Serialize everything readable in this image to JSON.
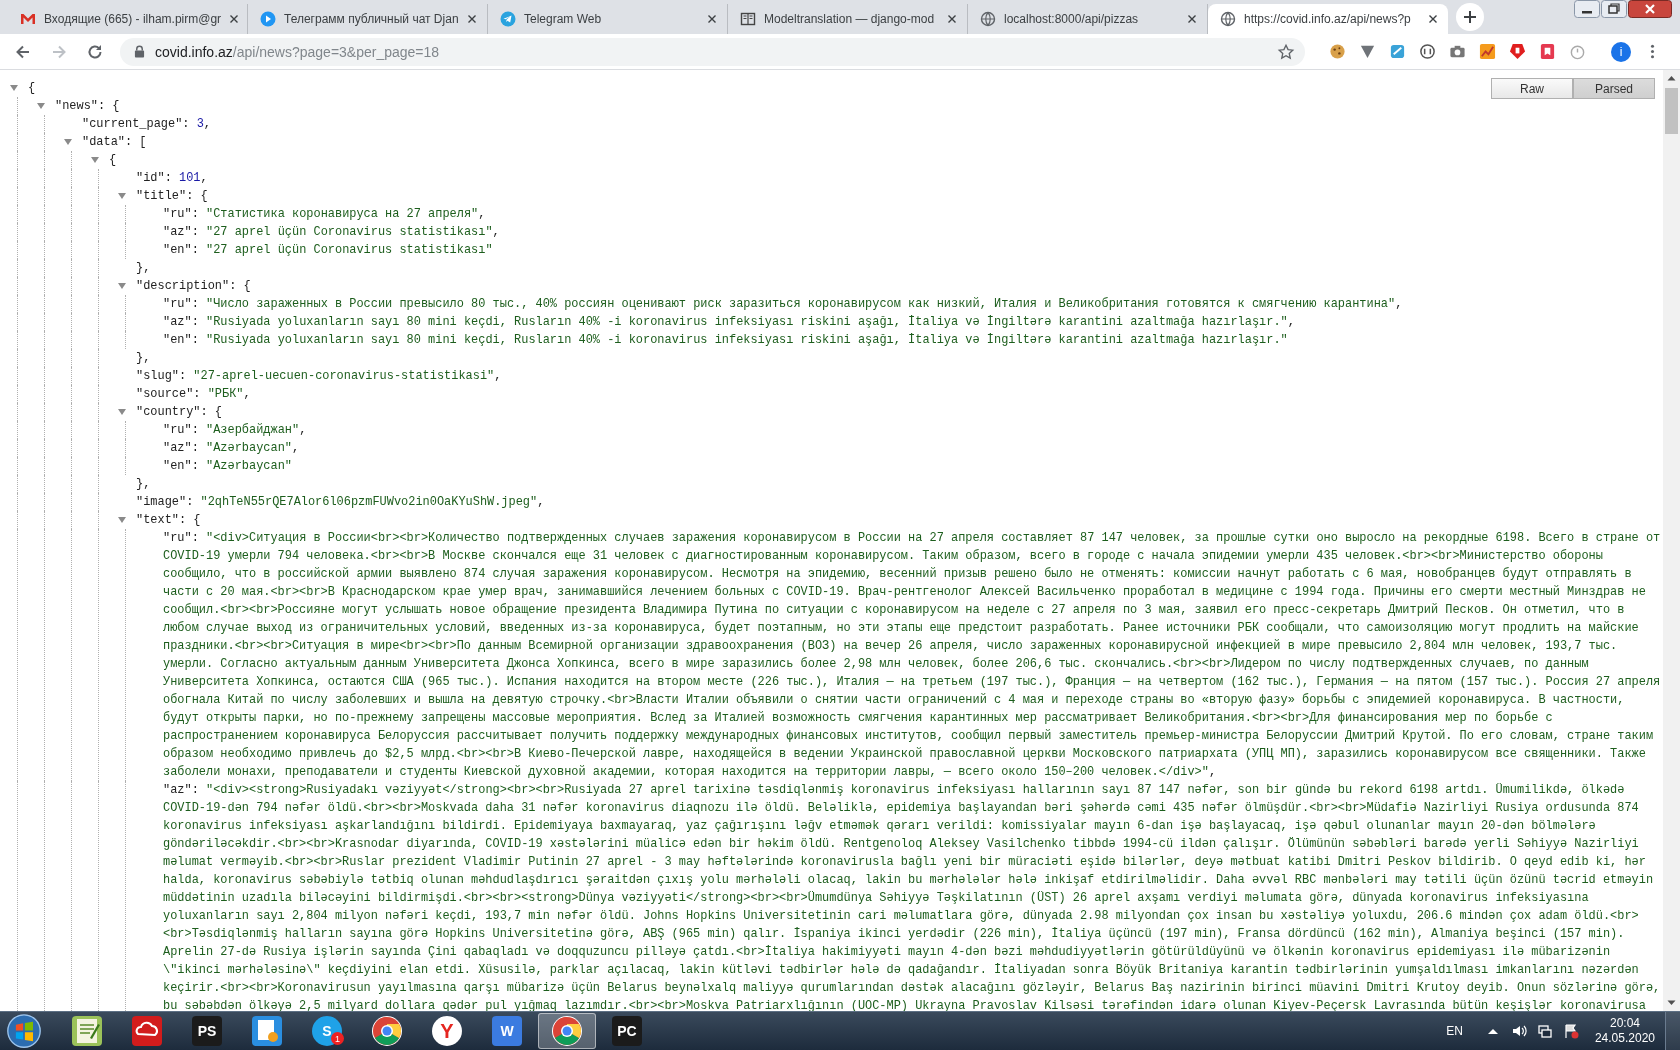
{
  "browser": {
    "tabs": [
      {
        "title": "Входящие (665) - ilham.pirm@gr",
        "kind": "mail",
        "selected": false
      },
      {
        "title": "Телеграмм публичный чат Djan",
        "kind": "play",
        "selected": false
      },
      {
        "title": "Telegram Web",
        "kind": "telegram",
        "selected": false
      },
      {
        "title": "Modeltranslation — django-mod",
        "kind": "book",
        "selected": false
      },
      {
        "title": "localhost:8000/api/pizzas",
        "kind": "globe",
        "selected": false
      },
      {
        "title": "https://covid.info.az/api/news?p",
        "kind": "globe",
        "selected": true
      }
    ],
    "url_host": "covid.info.az",
    "url_path": "/api/news?page=3&per_page=18",
    "profile": "i"
  },
  "viewer": {
    "buttons": [
      {
        "label": "Raw",
        "selected": false
      },
      {
        "label": "Parsed",
        "selected": true
      }
    ],
    "root": {
      "open": "{",
      "expanded": true,
      "children": [
        {
          "key": "\"news\":",
          "open": "{",
          "expanded": true,
          "children": [
            {
              "key": "\"current_page\":",
              "value": "3",
              "kind": "number",
              "tail": ","
            },
            {
              "key": "\"data\":",
              "open": "[",
              "expanded": true,
              "children": [
                {
                  "open": "{",
                  "expanded": true,
                  "children": [
                    {
                      "key": "\"id\":",
                      "value": "101",
                      "kind": "number",
                      "tail": ","
                    },
                    {
                      "key": "\"title\":",
                      "open": "{",
                      "expanded": true,
                      "close": "},",
                      "children": [
                        {
                          "key": "\"ru\":",
                          "value": "\"Статистика коронавируса на 27 апреля\"",
                          "kind": "string",
                          "tail": ","
                        },
                        {
                          "key": "\"az\":",
                          "value": "\"27 aprel üçün Coronavirus statistikası\"",
                          "kind": "string",
                          "tail": ","
                        },
                        {
                          "key": "\"en\":",
                          "value": "\"27 aprel üçün Coronavirus statistikası\"",
                          "kind": "string"
                        }
                      ]
                    },
                    {
                      "key": "\"description\":",
                      "open": "{",
                      "expanded": true,
                      "close": "},",
                      "children": [
                        {
                          "key": "\"ru\":",
                          "value": "\"Число зараженных в России превысило 80 тыс., 40% россиян оценивают риск заразиться коронавирусом как низкий, Италия и Великобритания готовятся к смягчению карантина\"",
                          "kind": "string",
                          "tail": ","
                        },
                        {
                          "key": "\"az\":",
                          "value": "\"Rusiyada yoluxanların sayı 80 mini keçdi, Rusların 40% -i koronavirus infeksiyası riskini aşağı, İtaliya və İngiltərə karantini azaltmağa hazırlaşır.\"",
                          "kind": "string",
                          "tail": ","
                        },
                        {
                          "key": "\"en\":",
                          "value": "\"Rusiyada yoluxanların sayı 80 mini keçdi, Rusların 40% -i koronavirus infeksiyası riskini aşağı, İtaliya və İngiltərə karantini azaltmağa hazırlaşır.\"",
                          "kind": "string"
                        }
                      ]
                    },
                    {
                      "key": "\"slug\":",
                      "value": "\"27-aprel-uecuen-coronavirus-statistikasi\"",
                      "kind": "string",
                      "tail": ","
                    },
                    {
                      "key": "\"source\":",
                      "value": "\"РБК\"",
                      "kind": "string",
                      "tail": ","
                    },
                    {
                      "key": "\"country\":",
                      "open": "{",
                      "expanded": true,
                      "close": "},",
                      "children": [
                        {
                          "key": "\"ru\":",
                          "value": "\"Азербайджан\"",
                          "kind": "string",
                          "tail": ","
                        },
                        {
                          "key": "\"az\":",
                          "value": "\"Azərbaycan\"",
                          "kind": "string",
                          "tail": ","
                        },
                        {
                          "key": "\"en\":",
                          "value": "\"Azərbaycan\"",
                          "kind": "string"
                        }
                      ]
                    },
                    {
                      "key": "\"image\":",
                      "value": "\"2qhTeN55rQE7Alor6l06pzmFUWvo2in0OaKYuShW.jpeg\"",
                      "kind": "string",
                      "tail": ","
                    },
                    {
                      "key": "\"text\":",
                      "open": "{",
                      "expanded": true,
                      "children": [
                        {
                          "key": "\"ru\":",
                          "value": "\"<div>Ситуация в России<br><br>Количество подтвержденных случаев заражения коронавирусом в России на 27 апреля составляет 87 147 человек, за прошлые сутки оно выросло на рекордные 6198. Всего в стране от COVID-19 умерли 794 человека.<br><br>В Москве скончался еще 31 человек с диагностированным коронавирусом. Таким образом, всего в городе с начала эпидемии умерли 435 человек.<br><br>Министерство обороны сообщило, что в российской армии выявлено 874 случая заражения коронавирусом. Несмотря на эпидемию, весенний призыв решено было не отменять: комиссии начнут работать с 6 мая, новобранцев будут отправлять в части с 20 мая.<br><br>В Краснодарском крае умер врач, занимавшийся лечением больных с COVID-19. Врач-рентгенолог Алексей Васильченко проработал в медицине с 1994 года. Причины его смерти местный Минздрав не сообщил.<br><br>Россияне могут услышать новое обращение президента Владимира Путина по ситуации с коронавирусом на неделе с 27 апреля по 3 мая, заявил его пресс-секретарь Дмитрий Песков. Он отметил, что в любом случае выход из ограничительных условий, введенных из-за коронавируса, будет поэтапным, но эти этапы еще предстоит разработать. Ранее источники РБК сообщали, что самоизоляцию могут продлить на майские праздники.<br><br>Ситуация в мире<br><br>По данным Всемирной организации здравоохранения (ВОЗ) на вечер 26 апреля, число зараженных коронавирусной инфекцией в мире превысило 2,804 млн человек, 193,7 тыс. умерли. Согласно актуальным данным Университета Джонса Хопкинса, всего в мире заразились более 2,98 млн человек, более 206,6 тыс. скончались.<br><br>Лидером по числу подтвержденных случаев, по данным Университета Хопкинса, остаются США (965 тыс.). Испания находится на втором месте (226 тыс.), Италия — на третьем (197 тыс.), Франция — на четвертом (162 тыс.), Германия — на пятом (157 тыс.). Россия 27 апреля обогнала Китай по числу заболевших и вышла на девятую строчку.<br>Власти Италии объявили о снятии части ограничений с 4 мая и переходе страны во «вторую фазу» борьбы с эпидемией коронавируса. В частности, будут открыты парки, но по-прежнему запрещены массовые мероприятия. Вслед за Италией возможность смягчения карантинных мер рассматривает Великобритания.<br><br>Для финансирования мер по борьбе с распространением коронавируса Белоруссия рассчитывает получить поддержку международных финансовых институтов, сообщил первый заместитель премьер-министра Белоруссии Дмитрий Крутой. По его словам, стране таким образом необходимо привлечь до $2,5 млрд.<br><br>В Киево-Печерской лавре, находящейся в ведении Украинской православной церкви Московского патриархата (УПЦ МП), заразились коронавирусом все священники. Также заболели монахи, преподаватели и студенты Киевской духовной академии, которая находится на территории лавры, — всего около 150–200 человек.</div>\"",
                          "kind": "string",
                          "tail": ","
                        },
                        {
                          "key": "\"az\":",
                          "value": "\"<div><strong>Rusiyadakı vəziyyət</strong><br><br>Rusiyada 27 aprel tarixinə təsdiqlənmiş koronavirus infeksiyası hallarının sayı 87 147 nəfər, son bir gündə bu rekord 6198 artdı. Ümumilikdə, ölkədə COVID-19-dən 794 nəfər öldü.<br><br>Moskvada daha 31 nəfər koronavirus diaqnozu ilə öldü. Beləliklə, epidemiya başlayandan bəri şəhərdə cəmi 435 nəfər ölmüşdür.<br><br>Müdafiə Nazirliyi Rusiya ordusunda 874 koronavirus infeksiyası aşkarlandığını bildirdi. Epidemiyaya baxmayaraq, yaz çağırışını ləğv etməmək qərarı verildi: komissiyalar mayın 6-dan işə başlayacaq, işə qəbul olunanlar mayın 20-dən bölmələrə göndəriləcəkdir.<br><br>Krasnodar diyarında, COVID-19 xəstələrini müalicə edən bir həkim öldü. Rentgenoloq Aleksey Vasilchenko tibbdə 1994-cü ildən çalışır. Ölümünün səbəbləri barədə yerli Səhiyyə Nazirliyi məlumat verməyib.<br><br>Ruslar prezident Vladimir Putinin 27 aprel - 3 may həftələrində koronavirusla bağlı yeni bir müraciəti eşidə bilərlər, deyə mətbuat katibi Dmitri Peskov bildirib. O qeyd edib ki, hər halda, koronavirus səbəbiylə tətbiq olunan məhdudlaşdırıcı şəraitdən çıxış yolu mərhələli olacaq, lakin bu mərhələlər hələ inkişaf etdirilməlidir. Daha əvvəl RBC mənbələri may tətili üçün özünü təcrid etməyin müddətinin uzadıla biləcəyini bildirmişdi.<br><br><strong>Dünya vəziyyəti</strong><br><br>Ümumdünya Səhiyyə Təşkilatının (ÜST) 26 aprel axşamı verdiyi məlumata görə, dünyada koronavirus infeksiyasına yoluxanların sayı 2,804 milyon nəfəri keçdi, 193,7 min nəfər öldü. Johns Hopkins Universitetinin cari məlumatlara görə, dünyada 2.98 milyondan çox insan bu xəstəliyə yoluxdu, 206.6 mindən çox adam öldü.<br><br>Təsdiqlənmiş halların sayına görə Hopkins Universitetinə görə, ABŞ (965 min) qalır. İspaniya ikinci yerdədir (226 min), İtaliya üçüncü (197 min), Fransa dördüncü (162 min), Almaniya beşinci (157 min). Aprelin 27-də Rusiya işlərin sayında Çini qabaqladı və doqquzuncu pilləyə çatdı.<br>İtaliya hakimiyyəti mayın 4-dən bəzi məhdudiyyətlərin götürüldüyünü və ölkənin koronavirus epidemiyası ilə mübarizənin \\\"ikinci mərhələsinə\\\" keçdiyini elan etdi. Xüsusilə, parklar açılacaq, lakin kütləvi tədbirlər hələ də qadağandır. İtaliyadan sonra Böyük Britaniya karantin tədbirlərinin yumşaldılması imkanlarını nəzərdən keçirir.<br><br>Koronavirusun yayılmasına qarşı mübarizə üçün Belarus beynəlxalq maliyyə qurumlarından dəstək alacağını gözləyir, Belarus Baş nazirinin birinci müavini Dmitri Krutoy deyib. Onun sözlərinə görə, bu səbəbdən ölkəyə 2,5 milyard dollara qədər pul yığmaq lazımdır.<br><br>Moskva Patriarxlığının (UOC-MP) Ukrayna Pravoslav Kilsəsi tərəfindən idarə olunan Kiyev-Peçersk Lavrasında bütün keşişlər koronavirusa",
                          "kind": "string"
                        }
                      ]
                    }
                  ]
                }
              ]
            }
          ]
        }
      ]
    }
  },
  "taskbar": {
    "apps": [
      {
        "kind": "notepad",
        "selected": false
      },
      {
        "kind": "cloud",
        "selected": false
      },
      {
        "kind": "phpstorm",
        "glyph": "PS",
        "selected": false
      },
      {
        "kind": "gearapp",
        "selected": false
      },
      {
        "kind": "skype",
        "glyph": "S",
        "badge": "1",
        "selected": false
      },
      {
        "kind": "chrome",
        "selected": false
      },
      {
        "kind": "yandex",
        "glyph": "Y",
        "selected": false
      },
      {
        "kind": "wps",
        "glyph": "W",
        "selected": false
      },
      {
        "kind": "chrome",
        "selected": true
      },
      {
        "kind": "pycharm",
        "glyph": "PC",
        "selected": false
      }
    ],
    "language": "EN",
    "time": "20:04",
    "date": "24.05.2020"
  }
}
